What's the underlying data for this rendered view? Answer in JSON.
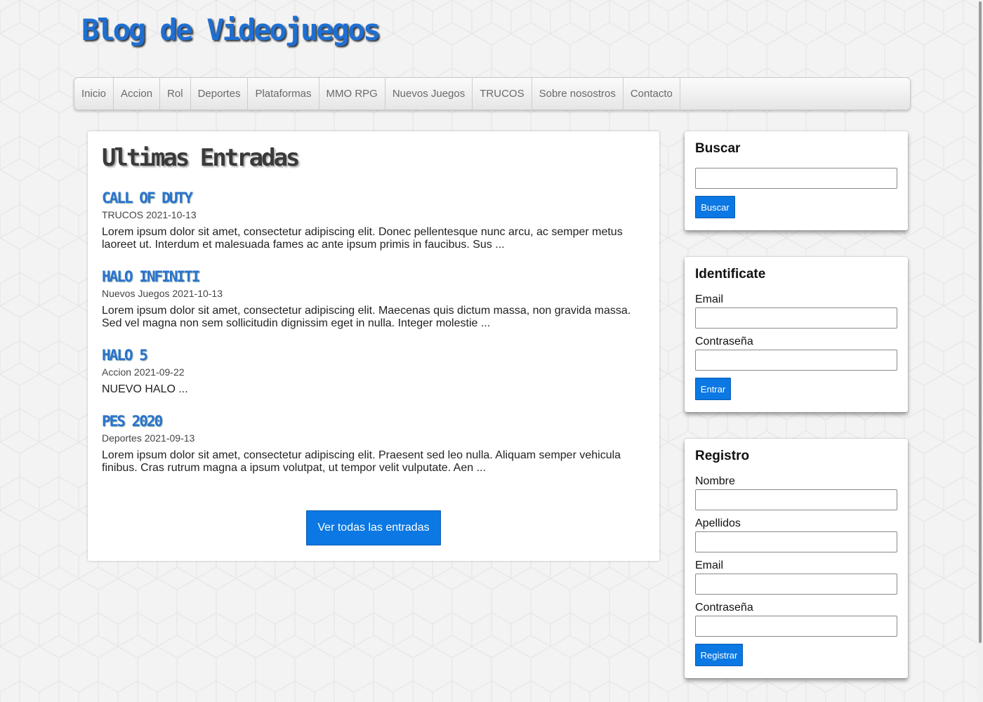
{
  "header": {
    "title": "Blog de Videojuegos"
  },
  "nav": {
    "items": [
      "Inicio",
      "Accion",
      "Rol",
      "Deportes",
      "Plataformas",
      "MMO RPG",
      "Nuevos Juegos",
      "TRUCOS",
      "Sobre nosostros",
      "Contacto"
    ]
  },
  "main": {
    "heading": "Ultimas Entradas",
    "posts": [
      {
        "title": "CALL OF DUTY",
        "meta": "TRUCOS 2021-10-13",
        "excerpt": "Lorem ipsum dolor sit amet, consectetur adipiscing elit. Donec pellentesque nunc arcu, ac semper metus laoreet ut. Interdum et malesuada fames ac ante ipsum primis in faucibus. Sus ..."
      },
      {
        "title": "HALO INFINITI",
        "meta": "Nuevos Juegos 2021-10-13",
        "excerpt": "Lorem ipsum dolor sit amet, consectetur adipiscing elit. Maecenas quis dictum massa, non gravida massa. Sed vel magna non sem sollicitudin dignissim eget in nulla. Integer molestie ..."
      },
      {
        "title": "HALO 5",
        "meta": "Accion 2021-09-22",
        "excerpt": "NUEVO HALO ..."
      },
      {
        "title": "PES 2020",
        "meta": "Deportes 2021-09-13",
        "excerpt": "Lorem ipsum dolor sit amet, consectetur adipiscing elit. Praesent sed leo nulla. Aliquam semper vehicula finibus. Cras rutrum magna a ipsum volutpat, ut tempor velit vulputate. Aen ..."
      }
    ],
    "view_all_label": "Ver todas las entradas"
  },
  "sidebar": {
    "search": {
      "title": "Buscar",
      "input_value": "",
      "button_label": "Buscar"
    },
    "login": {
      "title": "Identificate",
      "email_label": "Email",
      "password_label": "Contraseña",
      "button_label": "Entrar"
    },
    "register": {
      "title": "Registro",
      "name_label": "Nombre",
      "surname_label": "Apellidos",
      "email_label": "Email",
      "password_label": "Contraseña",
      "button_label": "Registrar"
    }
  },
  "colors": {
    "accent": "#0b78e3",
    "title_blue": "#1f6fd1",
    "post_title_blue": "#2b73cc",
    "page_background": "#f3f3f3"
  }
}
